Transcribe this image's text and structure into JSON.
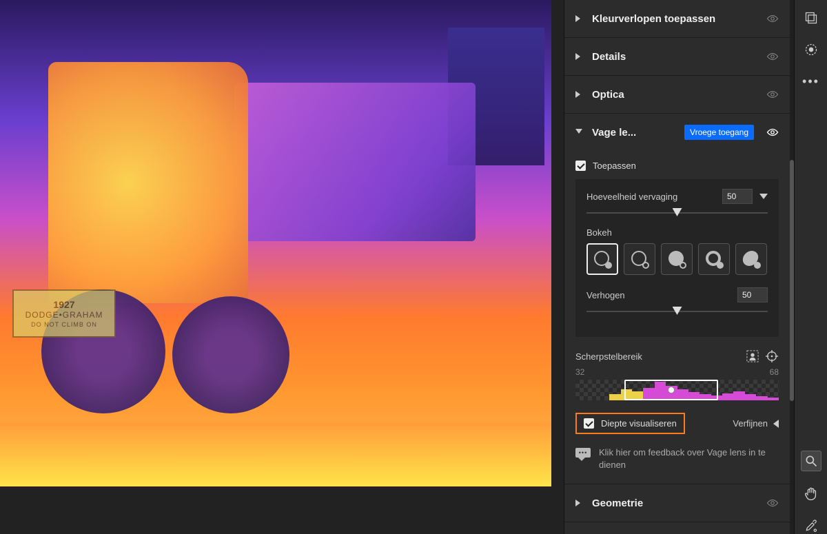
{
  "sections": {
    "gradients": {
      "title": "Kleurverlopen toepassen"
    },
    "details": {
      "title": "Details"
    },
    "optics": {
      "title": "Optica"
    },
    "lensblur": {
      "title": "Vage le...",
      "badge": "Vroege toegang",
      "apply_label": "Toepassen",
      "apply_checked": true,
      "blur_amount": {
        "label": "Hoeveelheid vervaging",
        "value": "50",
        "pos_pct": 50
      },
      "bokeh_label": "Bokeh",
      "bokeh_selected": 0,
      "boost": {
        "label": "Verhogen",
        "value": "50",
        "pos_pct": 50
      },
      "range": {
        "label": "Scherpstelbereik",
        "min": "32",
        "max": "68",
        "win_left_pct": 24,
        "win_right_pct": 70,
        "pin_pct": 47
      },
      "visualise": {
        "label": "Diepte visualiseren",
        "checked": true
      },
      "refine_label": "Verfijnen",
      "feedback": "Klik hier om feedback over Vage lens in te dienen"
    },
    "geometry": {
      "title": "Geometrie"
    }
  },
  "plate": {
    "year": "1927",
    "brand": "DODGE•GRAHAM",
    "warning": "DO NOT CLIMB ON"
  }
}
